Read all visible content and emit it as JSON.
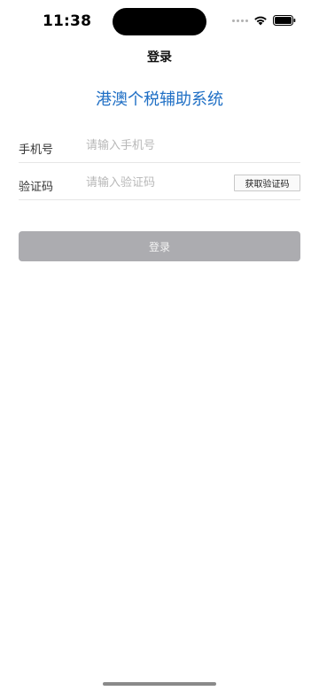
{
  "status_bar": {
    "time": "11:38"
  },
  "nav": {
    "title": "登录"
  },
  "app": {
    "title": "港澳个税辅助系统"
  },
  "form": {
    "phone": {
      "label": "手机号",
      "placeholder": "请输入手机号",
      "value": ""
    },
    "code": {
      "label": "验证码",
      "placeholder": "请输入验证码",
      "value": "",
      "get_code_label": "获取验证码"
    }
  },
  "login_button": {
    "label": "登录"
  },
  "colors": {
    "accent": "#1f6fc5",
    "button_disabled": "#acacb0"
  },
  "icons": [
    "signal-dots-icon",
    "wifi-icon",
    "battery-icon"
  ]
}
